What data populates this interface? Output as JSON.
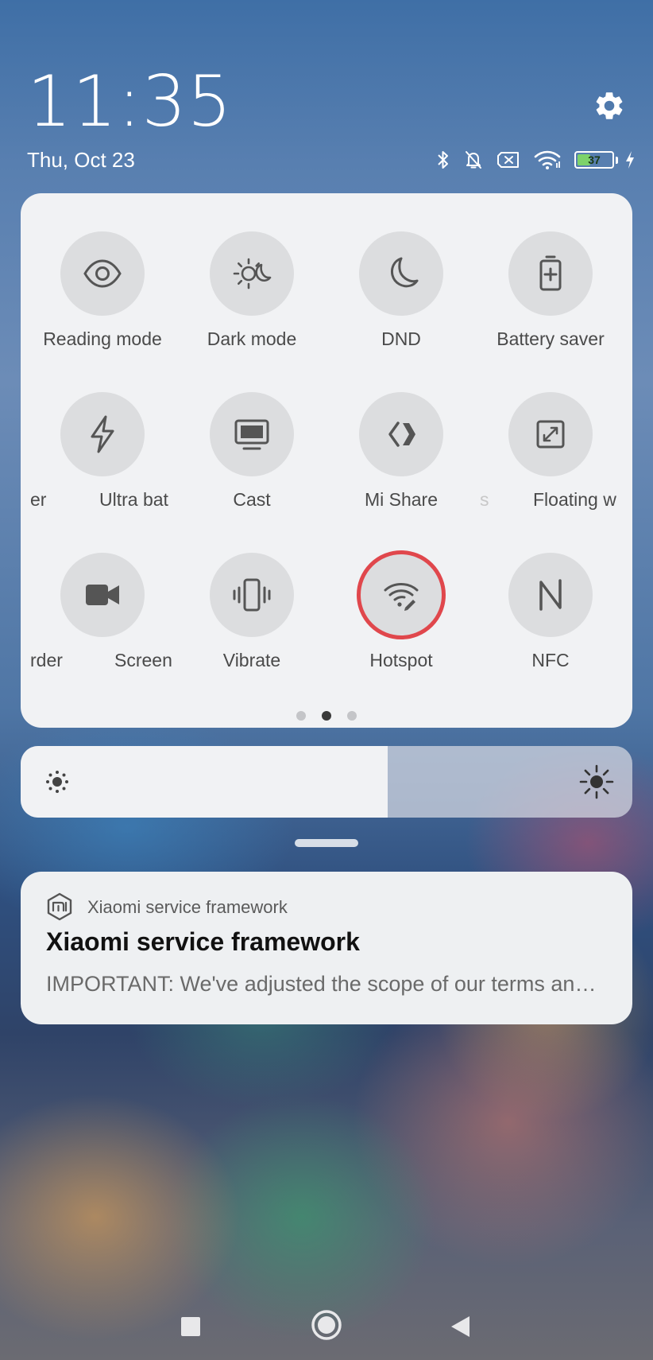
{
  "header": {
    "time": "11:35",
    "date": "Thu, Oct 23",
    "settings_icon": "gear-icon"
  },
  "status_bar": {
    "icons": [
      "bluetooth-icon",
      "bell-muted-icon",
      "sim-missing-icon",
      "wifi-icon",
      "battery-icon",
      "charging-icon"
    ],
    "battery_level": "37",
    "battery_color": "#7dd36a"
  },
  "quick_settings": {
    "row1": [
      {
        "label": "Reading mode",
        "icon": "eye-icon"
      },
      {
        "label": "Dark mode",
        "icon": "dark-mode-icon"
      },
      {
        "label": "DND",
        "icon": "moon-icon"
      },
      {
        "label": "Battery saver",
        "icon": "battery-plus-icon"
      }
    ],
    "row2": [
      {
        "label": "Ultra bat",
        "icon": "lightning-icon"
      },
      {
        "label": "Cast",
        "icon": "monitor-icon"
      },
      {
        "label": "Mi Share",
        "icon": "mi-share-icon"
      },
      {
        "label": "Floating w",
        "icon": "floating-window-icon"
      }
    ],
    "row2_fragments": [
      "er",
      "s"
    ],
    "row3": [
      {
        "label": "Screen",
        "icon": "video-camera-icon"
      },
      {
        "label": "Vibrate",
        "icon": "vibrate-icon"
      },
      {
        "label": "Hotspot",
        "icon": "hotspot-icon"
      },
      {
        "label": "NFC",
        "icon": "nfc-icon"
      }
    ],
    "row3_fragments": [
      "rder"
    ],
    "highlight_color": "#e0474c",
    "page_count": 3,
    "active_page": 2
  },
  "brightness": {
    "level": 0.6,
    "low_icon": "sun-small-icon",
    "high_icon": "sun-large-icon"
  },
  "notification": {
    "app_name": "Xiaomi service framework",
    "app_icon": "mi-logo-icon",
    "title": "Xiaomi service framework",
    "text": "IMPORTANT: We've adjusted the scope of our terms and privacy policy"
  },
  "nav": {
    "recent": "recent-apps-icon",
    "home": "home-icon",
    "back": "back-icon"
  }
}
